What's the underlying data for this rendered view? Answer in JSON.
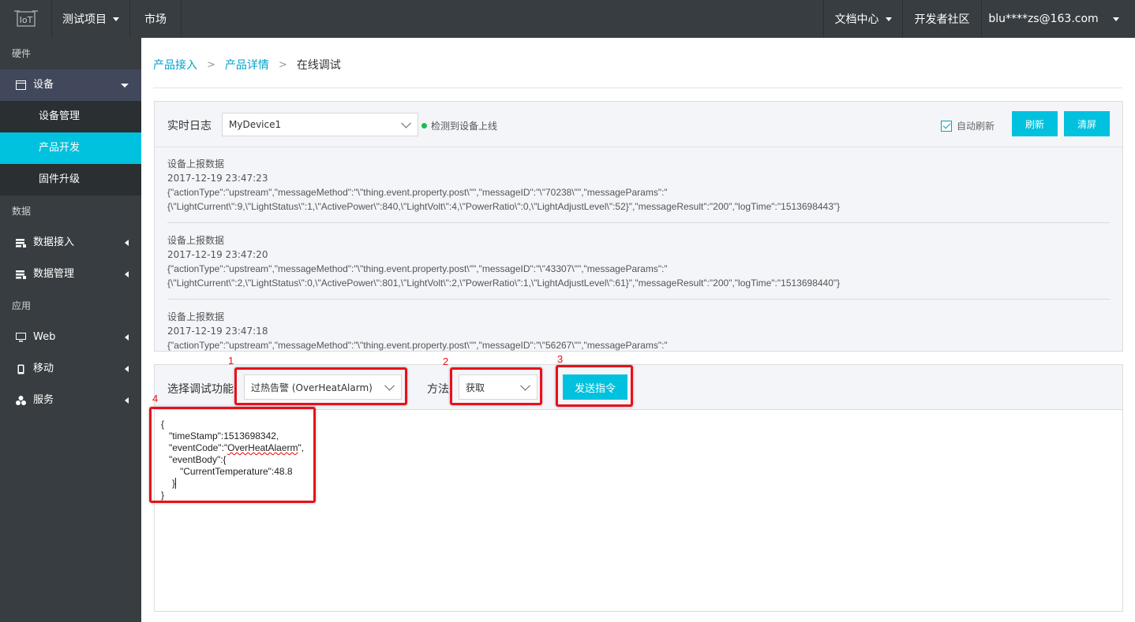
{
  "topbar": {
    "logo_icon": "iot-logo-icon",
    "project": "测试项目",
    "market": "市场",
    "docs": "文档中心",
    "community": "开发者社区",
    "user": "blu****zs@163.com"
  },
  "sidebar": {
    "groups": [
      "硬件",
      "数据",
      "应用"
    ],
    "items": [
      {
        "label": "设备",
        "icon": "device-icon"
      },
      {
        "label": "数据接入",
        "icon": "data-access-icon"
      },
      {
        "label": "数据管理",
        "icon": "data-manage-icon"
      },
      {
        "label": "Web",
        "icon": "monitor-icon"
      },
      {
        "label": "移动",
        "icon": "mobile-icon"
      },
      {
        "label": "服务",
        "icon": "service-icon"
      }
    ],
    "sub_items": [
      "设备管理",
      "产品开发",
      "固件升级"
    ],
    "active_sub": "产品开发"
  },
  "breadcrumb": {
    "items": [
      "产品接入",
      "产品详情"
    ],
    "current": "在线调试"
  },
  "log_panel": {
    "title": "实时日志",
    "device": "MyDevice1",
    "status": "检测到设备上线",
    "auto_refresh_label": "自动刷新",
    "auto_refresh_checked": true,
    "refresh_btn": "刷新",
    "clear_btn": "清屏",
    "entries": [
      {
        "title": "设备上报数据",
        "time": "2017-12-19 23:47:23",
        "line1": "{\"actionType\":\"upstream\",\"messageMethod\":\"\\\"thing.event.property.post\\\"\",\"messageID\":\"\\\"70238\\\"\",\"messageParams\":\"",
        "line2": "{\\\"LightCurrent\\\":9,\\\"LightStatus\\\":1,\\\"ActivePower\\\":840,\\\"LightVolt\\\":4,\\\"PowerRatio\\\":0,\\\"LightAdjustLevel\\\":52}\",\"messageResult\":\"200\",\"logTime\":\"1513698443\"}"
      },
      {
        "title": "设备上报数据",
        "time": "2017-12-19 23:47:20",
        "line1": "{\"actionType\":\"upstream\",\"messageMethod\":\"\\\"thing.event.property.post\\\"\",\"messageID\":\"\\\"43307\\\"\",\"messageParams\":\"",
        "line2": "{\\\"LightCurrent\\\":2,\\\"LightStatus\\\":0,\\\"ActivePower\\\":801,\\\"LightVolt\\\":2,\\\"PowerRatio\\\":1,\\\"LightAdjustLevel\\\":61}\",\"messageResult\":\"200\",\"logTime\":\"1513698440\"}"
      },
      {
        "title": "设备上报数据",
        "time": "2017-12-19 23:47:18",
        "line1": "{\"actionType\":\"upstream\",\"messageMethod\":\"\\\"thing.event.property.post\\\"\",\"messageID\":\"\\\"56267\\\"\",\"messageParams\":\"",
        "line2": ""
      }
    ]
  },
  "debug_panel": {
    "function_label": "选择调试功能",
    "function_value": "过热告警 (OverHeatAlarm)",
    "method_label": "方法",
    "method_value": "获取",
    "send_btn": "发送指令",
    "editor_lines": [
      "{",
      "\"timeStamp\":1513698342,",
      "\"eventCode\":\"",
      "OverHeatAlaerm",
      "\",",
      "\"eventBody\":{",
      "\"CurrentTemperature\":48.8",
      "}",
      "}"
    ]
  },
  "annotations": [
    "1",
    "2",
    "3",
    "4"
  ],
  "colors": {
    "accent": "#00c1de",
    "sidebar_bg": "#373d41",
    "annotation_red": "#e8101a"
  }
}
